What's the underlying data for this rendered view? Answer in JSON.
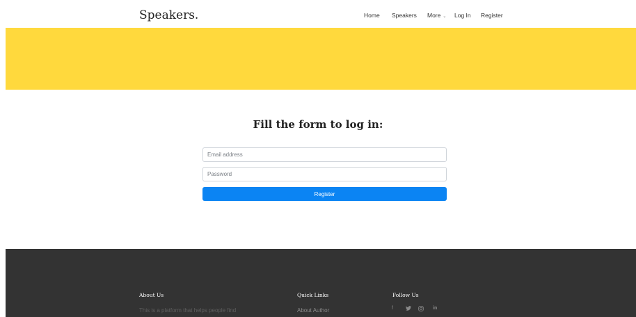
{
  "navbar": {
    "brand": "Speakers.",
    "links": {
      "home": "Home",
      "speakers": "Speakers",
      "more": "More",
      "login": "Log In",
      "register": "Register"
    }
  },
  "hero": {
    "color": "#ffd93d"
  },
  "form": {
    "title": "Fill the form to log in:",
    "email_placeholder": "Email address",
    "password_placeholder": "Password",
    "submit_label": "Register",
    "submit_color": "#0b84f3"
  },
  "footer": {
    "about": {
      "heading": "About Us",
      "text": "This is a platform that helps people find"
    },
    "quick_links": {
      "heading": "Quick Links",
      "items": [
        "About Author"
      ]
    },
    "follow": {
      "heading": "Follow Us",
      "icons": [
        "facebook-icon",
        "twitter-icon",
        "instagram-icon",
        "linkedin-icon"
      ]
    }
  }
}
